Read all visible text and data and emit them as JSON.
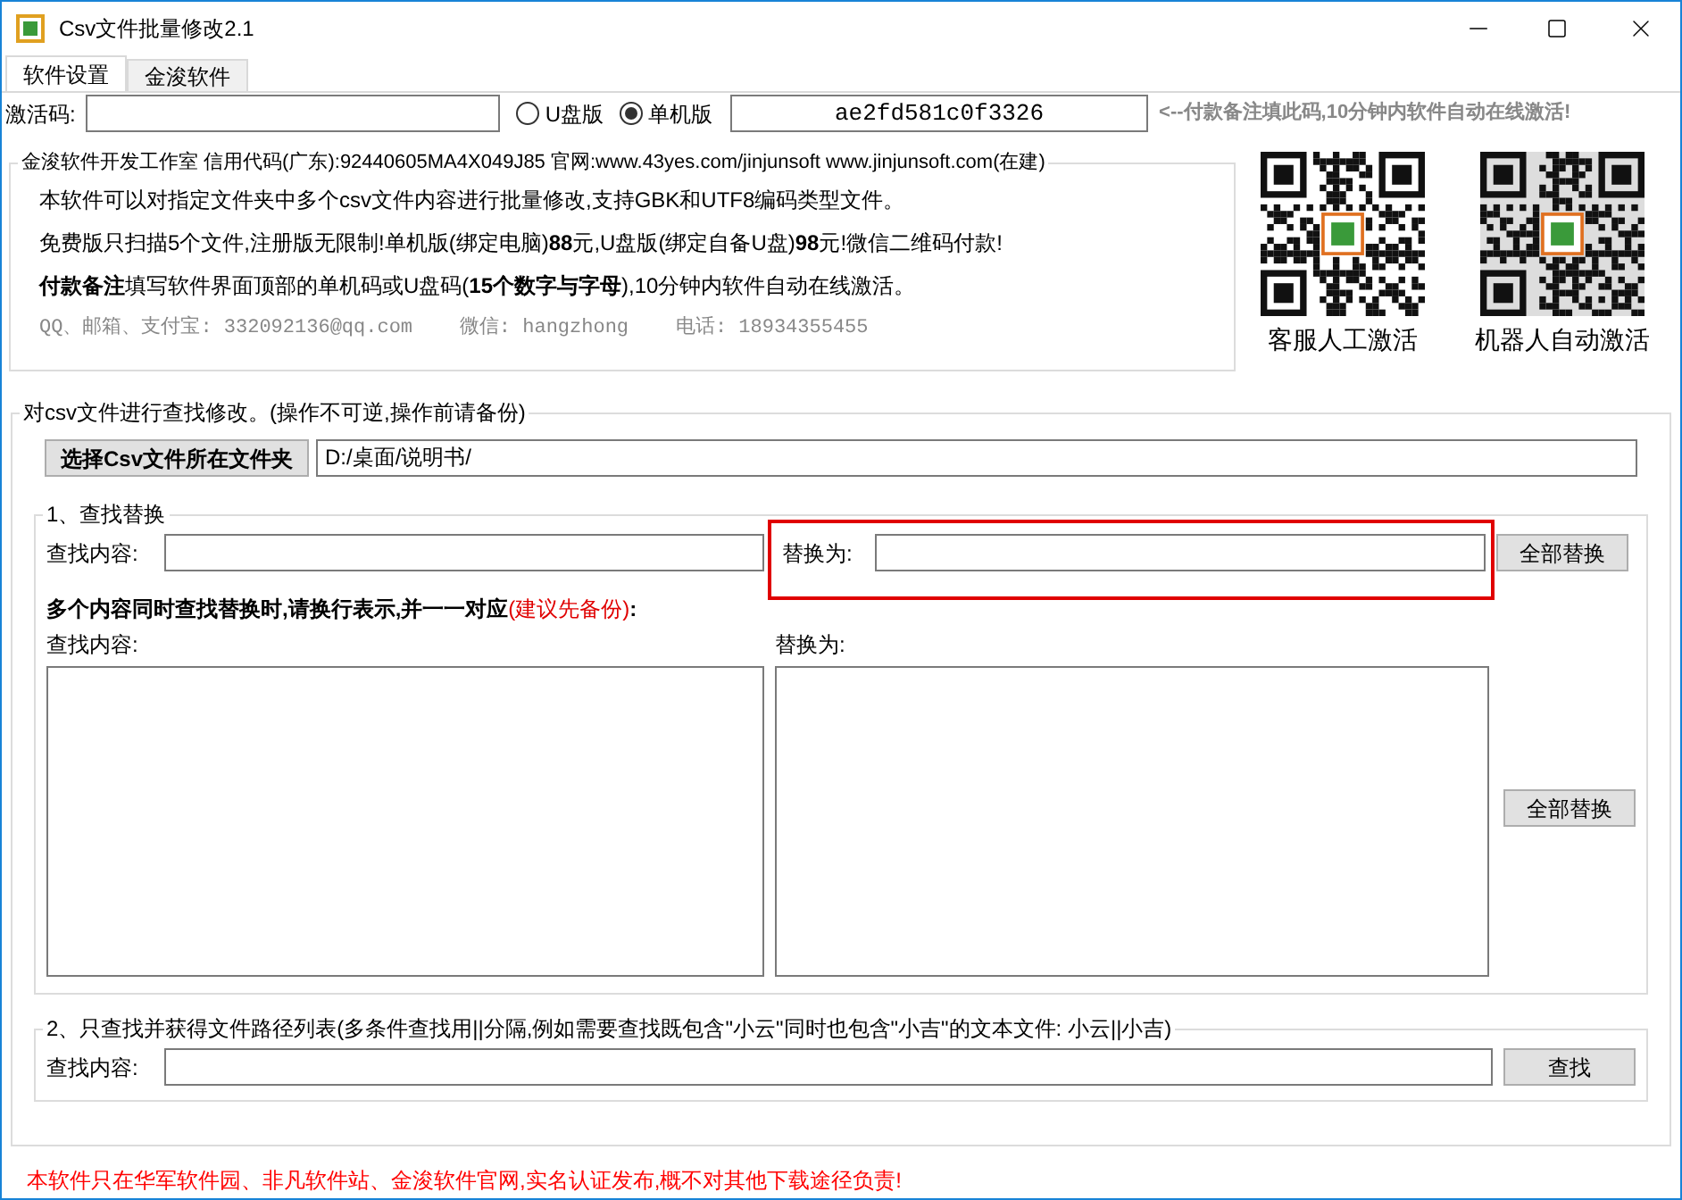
{
  "window": {
    "title": "Csv文件批量修改2.1"
  },
  "tabs": [
    {
      "label": "软件设置",
      "selected": true
    },
    {
      "label": "金浚软件",
      "selected": false
    }
  ],
  "activation": {
    "label": "激活码:",
    "radios": [
      {
        "label": "U盘版",
        "selected": false
      },
      {
        "label": "单机版",
        "selected": true
      }
    ],
    "machine_code": "ae2fd581c0f3326",
    "note": "<--付款备注填此码,10分钟内软件自动在线激活!"
  },
  "info": {
    "legend": "金浚软件开发工作室 信用代码(广东):92440605MA4X049J85 官网:www.43yes.com/jinjunsoft  www.jinjunsoft.com(在建)",
    "lines": [
      "本软件可以对指定文件夹中多个csv文件内容进行批量修改,支持GBK和UTF8编码类型文件。",
      "免费版只扫描5个文件,注册版无限制!单机版(绑定电脑)**88**元,U盘版(绑定自备U盘)**98**元!微信二维码付款!",
      "**付款备注**填写软件界面顶部的单机码或U盘码(**15个数字与字母**),10分钟内软件自动在线激活。"
    ],
    "contact": "QQ、邮箱、支付宝: 332092136@qq.com    微信: hangzhong    电话: 18934355455"
  },
  "qr_codes": [
    {
      "caption": "客服人工激活"
    },
    {
      "caption": "机器人自动激活"
    }
  ],
  "main": {
    "legend": "对csv文件进行查找修改。(操作不可逆,操作前请备份)",
    "choose_button": "选择Csv文件所在文件夹",
    "folder_path": "D:/桌面/说明书/",
    "section1": {
      "legend": "1、查找替换",
      "find_label": "查找内容:",
      "replace_label": "替换为:",
      "replace_all_button": "全部替换",
      "multi_note": "多个内容同时查找替换时,请换行表示,并一一对应",
      "multi_hint": "(建议先备份)",
      "multi_colon": ":",
      "find_label2": "查找内容:",
      "replace_label2": "替换为:",
      "replace_all_button2": "全部替换"
    },
    "section2": {
      "legend": "2、只查找并获得文件路径列表(多条件查找用||分隔,例如需要查找既包含\"小云\"同时也包含\"小吉\"的文本文件: 小云||小吉)",
      "find_label": "查找内容:",
      "find_button": "查找"
    }
  },
  "footer": "本软件只在华军软件园、非凡软件站、金浚软件官网,实名认证发布,概不对其他下载途径负责!"
}
